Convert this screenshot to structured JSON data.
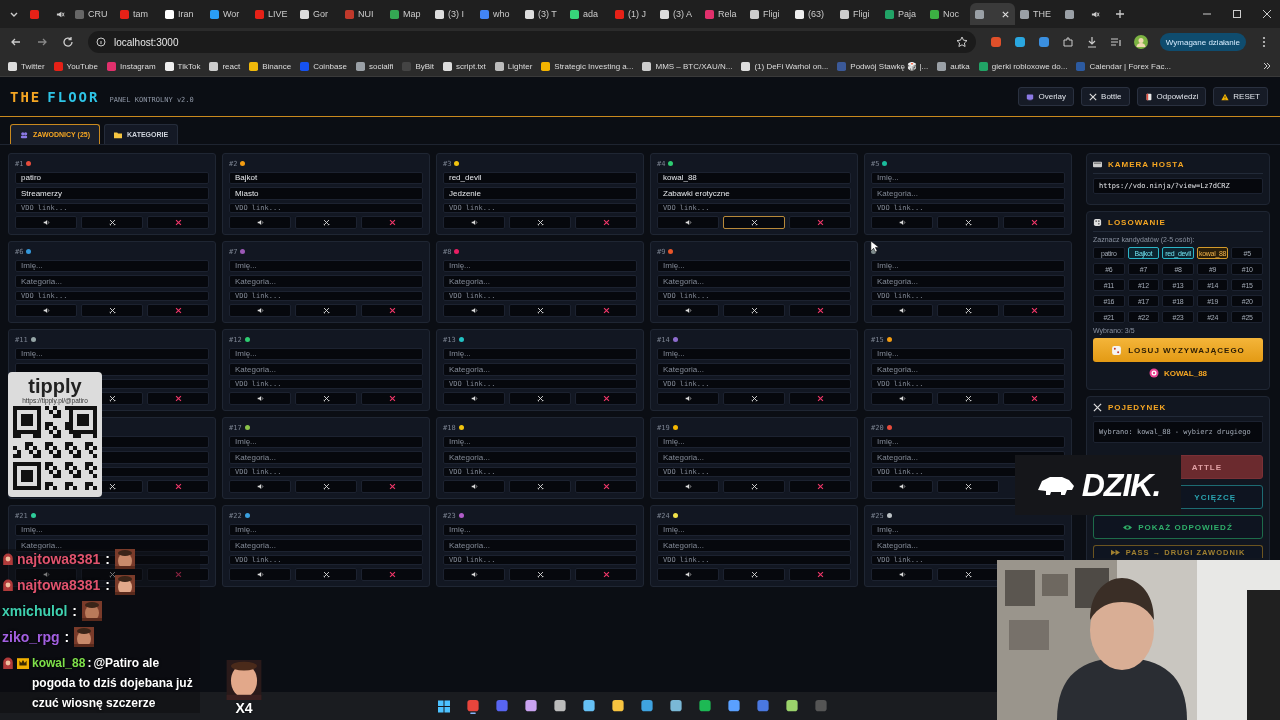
{
  "browser": {
    "tabs": [
      {
        "color": "#e62117",
        "selected": false,
        "muted": true
      },
      {
        "title": "CRU",
        "color": "#666666",
        "selected": false
      },
      {
        "title": "tam",
        "color": "#e62117",
        "selected": false
      },
      {
        "title": "Iran",
        "color": "#ffffff",
        "selected": false
      },
      {
        "title": "Wor",
        "color": "#2a9df4",
        "selected": false
      },
      {
        "title": "LIVE",
        "color": "#e62117",
        "selected": false
      },
      {
        "title": "Gor",
        "color": "#dddddd",
        "selected": false
      },
      {
        "title": "NUI",
        "color": "#c0392b",
        "selected": false
      },
      {
        "title": "Map",
        "color": "#34a853",
        "selected": false
      },
      {
        "title": "(3) I",
        "color": "#dddddd",
        "selected": false
      },
      {
        "title": "who",
        "color": "#4285f4",
        "selected": false
      },
      {
        "title": "(3) T",
        "color": "#dddddd",
        "selected": false
      },
      {
        "title": "ada",
        "color": "#37d67a",
        "selected": false
      },
      {
        "title": "(1) J",
        "color": "#e62117",
        "selected": false
      },
      {
        "title": "(3) A",
        "color": "#dddddd",
        "selected": false
      },
      {
        "title": "Rela",
        "color": "#e1306c",
        "selected": false
      },
      {
        "title": "Fligi",
        "color": "#cccccc",
        "selected": false
      },
      {
        "title": "(63)",
        "color": "#eeeeee",
        "selected": false
      },
      {
        "title": "Fligi",
        "color": "#cccccc",
        "selected": false
      },
      {
        "title": "Paja",
        "color": "#21a366",
        "selected": false
      },
      {
        "title": "Noc",
        "color": "#3cb043",
        "selected": false
      },
      {
        "color": "#9aa0a6",
        "selected": true
      },
      {
        "title": "THE",
        "color": "#9aa0a6",
        "selected": false
      },
      {
        "color": "#9aa0a6",
        "selected": false,
        "muted": true
      }
    ],
    "address": "localhost:3000",
    "action": "Wymagane działanie",
    "bookmarks": [
      {
        "label": "Twitter",
        "color": "#dddddd"
      },
      {
        "label": "YouTube",
        "color": "#e62117"
      },
      {
        "label": "Instagram",
        "color": "#e1306c"
      },
      {
        "label": "TikTok",
        "color": "#eeeeee"
      },
      {
        "label": "react",
        "color": "#cccccc"
      },
      {
        "label": "Binance",
        "color": "#f0b90b"
      },
      {
        "label": "Coinbase",
        "color": "#1652f0"
      },
      {
        "label": "socialfi",
        "color": "#9aa0a6"
      },
      {
        "label": "ByBit",
        "color": "#444444"
      },
      {
        "label": "script.txt",
        "color": "#dddddd"
      },
      {
        "label": "Lighter",
        "color": "#bbbbbb"
      },
      {
        "label": "Strategic Investing a...",
        "color": "#f4b400"
      },
      {
        "label": "MMS – BTC/XAU/N...",
        "color": "#cccccc"
      },
      {
        "label": "(1) DeFi Warhol on...",
        "color": "#dddddd"
      },
      {
        "label": "Podwój Stawkę 🎲 |...",
        "color": "#3b5998"
      },
      {
        "label": "autka",
        "color": "#9aa0a6"
      },
      {
        "label": "gierki robloxowe do...",
        "color": "#21a366"
      },
      {
        "label": "Calendar | Forex Fac...",
        "color": "#2c5aa0"
      }
    ]
  },
  "app": {
    "logo_first": "THE",
    "logo_second": "FLOOR",
    "subtitle": "PANEL KONTROLNY v2.0",
    "header_buttons": [
      {
        "kind": "overlay",
        "label": "Overlay"
      },
      {
        "kind": "bottle",
        "label": "Bottle"
      },
      {
        "kind": "answers",
        "label": "Odpowiedzi"
      },
      {
        "kind": "reset",
        "label": "RESET"
      }
    ],
    "tabs": [
      {
        "kind": "players",
        "label": "ZAWODNICY (25)",
        "selected": true
      },
      {
        "kind": "categories",
        "label": "KATEGORIE",
        "selected": false
      }
    ]
  },
  "cards": [
    {
      "number": "#1",
      "color": "#e74c3c",
      "name": {
        "value": "patiro"
      },
      "category": {
        "value": "Streamerzy"
      },
      "link": {
        "placeholder": "VDO link..."
      },
      "buttons": [
        {
          "kind": "sound"
        },
        {
          "kind": "battle",
          "selected": false
        },
        {
          "kind": "remove"
        }
      ]
    },
    {
      "number": "#2",
      "color": "#f39c12",
      "name": {
        "value": "Bajkot"
      },
      "category": {
        "value": "Miasto"
      },
      "link": {
        "placeholder": "VDO link..."
      },
      "buttons": [
        {
          "kind": "sound"
        },
        {
          "kind": "battle",
          "selected": false
        },
        {
          "kind": "remove"
        }
      ]
    },
    {
      "number": "#3",
      "color": "#f1c40f",
      "name": {
        "value": "red_devil"
      },
      "category": {
        "value": "Jedzenie"
      },
      "link": {
        "placeholder": "VDO link..."
      },
      "buttons": [
        {
          "kind": "sound"
        },
        {
          "kind": "battle",
          "selected": false
        },
        {
          "kind": "remove"
        }
      ]
    },
    {
      "number": "#4",
      "color": "#2ecc71",
      "name": {
        "value": "kowal_88"
      },
      "category": {
        "value": "Zabawki erotyczne"
      },
      "link": {
        "placeholder": "VDO link..."
      },
      "buttons": [
        {
          "kind": "sound"
        },
        {
          "kind": "battle",
          "selected": true
        },
        {
          "kind": "remove"
        }
      ]
    },
    {
      "number": "#5",
      "color": "#1abc9c",
      "name": {
        "placeholder": "Imię..."
      },
      "category": {
        "placeholder": "Kategoria..."
      },
      "link": {
        "placeholder": "VDO link..."
      },
      "buttons": [
        {
          "kind": "sound"
        },
        {
          "kind": "battle",
          "selected": false
        },
        {
          "kind": "remove"
        }
      ]
    },
    {
      "number": "#6",
      "color": "#3498db",
      "name": {
        "placeholder": "Imię..."
      },
      "category": {
        "placeholder": "Kategoria..."
      },
      "link": {
        "placeholder": "VDO link..."
      },
      "buttons": [
        {
          "kind": "sound"
        },
        {
          "kind": "battle",
          "selected": false
        },
        {
          "kind": "remove"
        }
      ]
    },
    {
      "number": "#7",
      "color": "#9b59b6",
      "name": {
        "placeholder": "Imię..."
      },
      "category": {
        "placeholder": "Kategoria..."
      },
      "link": {
        "placeholder": "VDO link..."
      },
      "buttons": [
        {
          "kind": "sound"
        },
        {
          "kind": "battle",
          "selected": false
        },
        {
          "kind": "remove"
        }
      ]
    },
    {
      "number": "#8",
      "color": "#e91e63",
      "name": {
        "placeholder": "Imię..."
      },
      "category": {
        "placeholder": "Kategoria..."
      },
      "link": {
        "placeholder": "VDO link..."
      },
      "buttons": [
        {
          "kind": "sound"
        },
        {
          "kind": "battle",
          "selected": false
        },
        {
          "kind": "remove"
        }
      ]
    },
    {
      "number": "#9",
      "color": "#e8562a",
      "name": {
        "placeholder": "Imię..."
      },
      "category": {
        "placeholder": "Kategoria..."
      },
      "link": {
        "placeholder": "VDO link..."
      },
      "buttons": [
        {
          "kind": "sound"
        },
        {
          "kind": "battle",
          "selected": false
        },
        {
          "kind": "remove"
        }
      ]
    },
    {
      "color": "#7f8c8d",
      "name": {
        "placeholder": "Imię..."
      },
      "category": {
        "placeholder": "Kategoria..."
      },
      "link": {
        "placeholder": "VDO link..."
      },
      "buttons": [
        {
          "kind": "sound"
        },
        {
          "kind": "battle",
          "selected": false
        },
        {
          "kind": "remove"
        }
      ]
    },
    {
      "number": "#11",
      "color": "#95a5a6",
      "name": {
        "placeholder": "Imię..."
      },
      "buttons": [
        {
          "kind": "covered"
        },
        {
          "kind": "battle",
          "selected": false
        },
        {
          "kind": "remove"
        }
      ]
    },
    {
      "number": "#12",
      "color": "#2ecc71",
      "name": {
        "placeholder": "Imię..."
      },
      "category": {
        "placeholder": "Kategoria..."
      },
      "link": {
        "placeholder": "VDO link..."
      },
      "buttons": [
        {
          "kind": "sound"
        },
        {
          "kind": "battle",
          "selected": false
        },
        {
          "kind": "remove"
        }
      ]
    },
    {
      "number": "#13",
      "color": "#22c1c3",
      "name": {
        "placeholder": "Imię..."
      },
      "category": {
        "placeholder": "Kategoria..."
      },
      "link": {
        "placeholder": "VDO link..."
      },
      "buttons": [
        {
          "kind": "sound"
        },
        {
          "kind": "battle",
          "selected": false
        },
        {
          "kind": "remove"
        }
      ]
    },
    {
      "number": "#14",
      "color": "#8e6ccf",
      "name": {
        "placeholder": "Imię..."
      },
      "category": {
        "placeholder": "Kategoria..."
      },
      "link": {
        "placeholder": "VDO link..."
      },
      "buttons": [
        {
          "kind": "sound"
        },
        {
          "kind": "battle",
          "selected": false
        },
        {
          "kind": "remove"
        }
      ]
    },
    {
      "number": "#15",
      "color": "#f39c12",
      "name": {
        "placeholder": "Imię..."
      },
      "category": {
        "placeholder": "Kategoria..."
      },
      "link": {
        "placeholder": "VDO link..."
      },
      "buttons": [
        {
          "kind": "sound"
        },
        {
          "kind": "battle",
          "selected": false
        },
        {
          "kind": "remove"
        }
      ]
    },
    {
      "buttons": [
        {
          "kind": "covered"
        },
        {
          "kind": "battle",
          "selected": false
        },
        {
          "kind": "remove"
        }
      ]
    },
    {
      "number": "#17",
      "color": "#8bc34a",
      "name": {
        "placeholder": "Imię..."
      },
      "category": {
        "placeholder": "Kategoria..."
      },
      "link": {
        "placeholder": "VDO link..."
      },
      "buttons": [
        {
          "kind": "sound"
        },
        {
          "kind": "battle",
          "selected": false
        },
        {
          "kind": "remove"
        }
      ]
    },
    {
      "number": "#18",
      "color": "#f1c40f",
      "name": {
        "placeholder": "Imię..."
      },
      "category": {
        "placeholder": "Kategoria..."
      },
      "link": {
        "placeholder": "VDO link..."
      },
      "buttons": [
        {
          "kind": "sound"
        },
        {
          "kind": "battle",
          "selected": false
        },
        {
          "kind": "remove"
        }
      ]
    },
    {
      "number": "#19",
      "color": "#f5b700",
      "name": {
        "placeholder": "Imię..."
      },
      "category": {
        "placeholder": "Kategoria..."
      },
      "link": {
        "placeholder": "VDO link..."
      },
      "buttons": [
        {
          "kind": "sound"
        },
        {
          "kind": "battle",
          "selected": false
        },
        {
          "kind": "remove"
        }
      ]
    },
    {
      "number": "#20",
      "color": "#e74c3c",
      "name": {
        "placeholder": "Imię..."
      },
      "category": {
        "placeholder": "Kategoria..."
      },
      "link": {
        "placeholder": "VDO link..."
      },
      "buttons": [
        {
          "kind": "sound"
        },
        {
          "kind": "battle",
          "selected": false
        },
        {
          "kind": "covered"
        }
      ]
    },
    {
      "number": "#21",
      "color": "#2ecc9a",
      "name": {
        "placeholder": "Imię..."
      },
      "category": {
        "placeholder": "Kategoria..."
      },
      "buttons": [
        {
          "kind": "sound"
        },
        {
          "kind": "battle",
          "selected": false
        },
        {
          "kind": "remove"
        }
      ]
    },
    {
      "number": "#22",
      "color": "#3aa0e0",
      "name": {
        "placeholder": "Imię..."
      },
      "category": {
        "placeholder": "Kategoria..."
      },
      "link": {
        "placeholder": "VDO link..."
      },
      "buttons": [
        {
          "kind": "sound"
        },
        {
          "kind": "battle",
          "selected": false
        },
        {
          "kind": "remove"
        }
      ]
    },
    {
      "number": "#23",
      "color": "#b05cc8",
      "name": {
        "placeholder": "Imię..."
      },
      "category": {
        "placeholder": "Kategoria..."
      },
      "link": {
        "placeholder": "VDO link..."
      },
      "buttons": [
        {
          "kind": "sound"
        },
        {
          "kind": "battle",
          "selected": false
        },
        {
          "kind": "remove"
        }
      ]
    },
    {
      "number": "#24",
      "color": "#f1e24a",
      "name": {
        "placeholder": "Imię..."
      },
      "category": {
        "placeholder": "Kategoria..."
      },
      "link": {
        "placeholder": "VDO link..."
      },
      "buttons": [
        {
          "kind": "sound"
        },
        {
          "kind": "battle",
          "selected": false
        },
        {
          "kind": "remove"
        }
      ]
    },
    {
      "number": "#25",
      "color": "#bdc3c7",
      "name": {
        "placeholder": "Imię..."
      },
      "category": {
        "placeholder": "Kategoria..."
      },
      "link": {
        "placeholder": "VDO link..."
      },
      "buttons": [
        {
          "kind": "sound"
        },
        {
          "kind": "battle",
          "selected": false
        },
        {
          "kind": "covered"
        }
      ]
    }
  ],
  "panel": {
    "camera": {
      "title": "KAMERA HOSTA",
      "url": "https://vdo.ninja/?view=Lz7dCRZ"
    },
    "draw": {
      "title": "LOSOWANIE",
      "hint": "Zaznacz kandydatów (2-5 osób):",
      "chips": [
        {
          "label": "patiro",
          "selected": false,
          "challenger": false
        },
        {
          "label": "Bajkot",
          "selected": true,
          "challenger": false
        },
        {
          "label": "red_devil",
          "selected": true,
          "challenger": false
        },
        {
          "label": "kowal_88",
          "selected": true,
          "challenger": true
        },
        {
          "label": "#5",
          "selected": false,
          "challenger": false
        },
        {
          "label": "#6",
          "selected": false,
          "challenger": false
        },
        {
          "label": "#7",
          "selected": false,
          "challenger": false
        },
        {
          "label": "#8",
          "selected": false,
          "challenger": false
        },
        {
          "label": "#9",
          "selected": false,
          "challenger": false
        },
        {
          "label": "#10",
          "selected": false,
          "challenger": false
        },
        {
          "label": "#11",
          "selected": false,
          "challenger": false
        },
        {
          "label": "#12",
          "selected": false,
          "challenger": false
        },
        {
          "label": "#13",
          "selected": false,
          "challenger": false
        },
        {
          "label": "#14",
          "selected": false,
          "challenger": false
        },
        {
          "label": "#15",
          "selected": false,
          "challenger": false
        },
        {
          "label": "#16",
          "selected": false,
          "challenger": false
        },
        {
          "label": "#17",
          "selected": false,
          "challenger": false
        },
        {
          "label": "#18",
          "selected": false,
          "challenger": false
        },
        {
          "label": "#19",
          "selected": false,
          "challenger": false
        },
        {
          "label": "#20",
          "selected": false,
          "challenger": false
        },
        {
          "label": "#21",
          "selected": false,
          "challenger": false
        },
        {
          "label": "#22",
          "selected": false,
          "challenger": false
        },
        {
          "label": "#23",
          "selected": false,
          "challenger": false
        },
        {
          "label": "#24",
          "selected": false,
          "challenger": false
        },
        {
          "label": "#25",
          "selected": false,
          "challenger": false
        }
      ],
      "count": "Wybrano: 3/5",
      "button": "LOSUJ WYZYWAJĄCEGO",
      "result": "KOWAL_88"
    },
    "duel": {
      "title": "POJEDYNEK",
      "info": "Wybrano: kowal_88 - wybierz drugiego",
      "buttons": [
        {
          "kind": "battle",
          "label": "ATTLE"
        },
        {
          "kind": "winner",
          "label": "YCIĘZCĘ"
        },
        {
          "kind": "answer",
          "label": "POKAŻ ODPOWIEDŹ"
        },
        {
          "kind": "pass",
          "label": "PASS → DRUGI ZAWODNIK"
        }
      ]
    }
  },
  "tipply": {
    "logo": "tipply",
    "url": "https://tipply.pl/@patiro"
  },
  "chat": [
    {
      "badges": [
        {
          "kind": "hood"
        }
      ],
      "user": "najtowa8381",
      "color": "#e0536e",
      "separator": ":",
      "kind": "emote"
    },
    {
      "badges": [
        {
          "kind": "hood"
        }
      ],
      "user": "najtowa8381",
      "color": "#e0536e",
      "separator": ":",
      "kind": "emote"
    },
    {
      "user": "xmichulol",
      "color": "#3fd1b0",
      "separator": ":",
      "kind": "emote"
    },
    {
      "user": "ziko_rpg",
      "color": "#a25fe0",
      "separator": ":",
      "kind": "emote"
    },
    {
      "badges": [
        {
          "kind": "hood"
        },
        {
          "kind": "crown"
        }
      ],
      "user": "kowal_88",
      "color": "#7ee04a",
      "separator": ":",
      "kind": "text",
      "text": "@Patiro ale pogoda to dziś dojebana już czuć wiosnę szczerze"
    }
  ],
  "big_emote": {
    "count": "X4"
  },
  "sponsor": {
    "logo": "DZIK."
  },
  "taskbar": [
    {
      "kind": "start",
      "color": "#4cc2ff"
    },
    {
      "kind": "app",
      "color": "#e8453c",
      "selected": true
    },
    {
      "kind": "app",
      "color": "#5865f2",
      "selected": false
    },
    {
      "kind": "app",
      "color": "#c9a2f0",
      "selected": false
    },
    {
      "kind": "app",
      "color": "#bbbbbb",
      "selected": false
    },
    {
      "kind": "app",
      "color": "#66c0f4",
      "selected": false
    },
    {
      "kind": "app",
      "color": "#f8c440",
      "selected": false
    },
    {
      "kind": "app",
      "color": "#3fa3e0",
      "selected": false
    },
    {
      "kind": "app",
      "color": "#7ab8d6",
      "selected": false
    },
    {
      "kind": "app",
      "color": "#1db954",
      "selected": false
    },
    {
      "kind": "app",
      "color": "#5aa0ff",
      "selected": false
    },
    {
      "kind": "app",
      "color": "#4a78e0",
      "selected": false
    },
    {
      "kind": "app",
      "color": "#9bd36b",
      "selected": false
    },
    {
      "kind": "app",
      "color": "#555555",
      "selected": false
    }
  ]
}
